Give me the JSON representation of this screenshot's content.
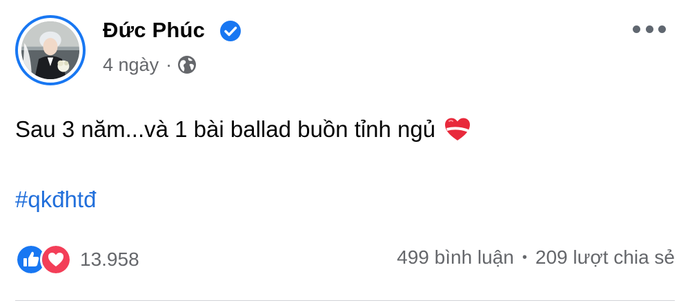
{
  "post": {
    "author": "Đức Phúc",
    "time": "4 ngày",
    "separator": "·",
    "text": "Sau 3 năm...và 1 bài ballad buồn tỉnh ngủ",
    "hashtag": "#qkđhtđ",
    "reaction_count": "13.958",
    "comments": "499 bình luận",
    "stats_separator": "•",
    "shares": "209 lượt chia sẻ"
  },
  "icons": {
    "verified": "verified-badge-icon",
    "audience": "globe-icon",
    "more": "more-options-icon",
    "like": "like-reaction-icon",
    "love": "love-reaction-icon",
    "emoji": "mending-heart-emoji"
  },
  "colors": {
    "accent": "#1877f2",
    "hashtag": "#216fdb",
    "secondary_text": "#65676b",
    "love": "#f33e58"
  }
}
